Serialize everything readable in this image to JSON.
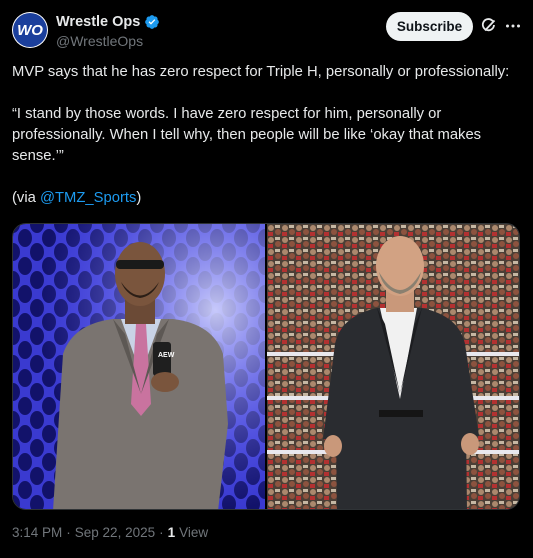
{
  "post": {
    "author": {
      "display_name": "Wrestle Ops",
      "handle": "@WrestleOps",
      "avatar_text": "WO",
      "verified": true
    },
    "actions": {
      "subscribe_label": "Subscribe",
      "grok_icon": "grok-icon",
      "more_icon": "more-icon"
    },
    "body": {
      "line1": "MVP says that he has zero respect for Triple H, personally or professionally:",
      "quote": "“I stand by those words. I have zero respect for him, personally or professionally. When I tell why, then people will be like ‘okay that makes sense.’”",
      "via_prefix": "(via ",
      "via_mention": "@TMZ_Sports",
      "via_suffix": ")"
    },
    "media": {
      "left_logo_text": "AEW"
    },
    "meta": {
      "time": "3:14 PM",
      "separator": "·",
      "date": "Sep 22, 2025",
      "views_count": "1",
      "views_label": "View"
    }
  },
  "colors": {
    "background": "#000000",
    "text": "#e7e9ea",
    "muted": "#71767b",
    "link": "#1d9bf0",
    "verified": "#1d9bf0"
  }
}
